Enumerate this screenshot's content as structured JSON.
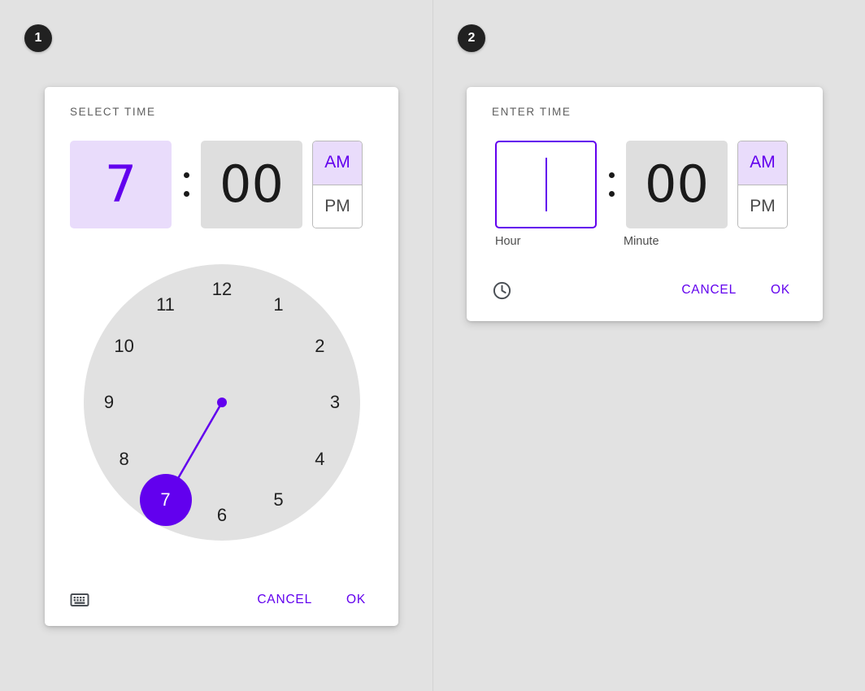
{
  "page": {
    "background_color": "#e2e2e2",
    "accent_color": "#6200ee",
    "accent_soft_color": "#e9dcfb",
    "field_color": "#dedede",
    "clock_face_color": "#e1e1e1"
  },
  "badges": [
    {
      "label": "1"
    },
    {
      "label": "2"
    }
  ],
  "select_time_dialog": {
    "title": "SELECT TIME",
    "hour_value": "7",
    "separator": ":",
    "minute_value": "00",
    "meridiem": {
      "am_label": "AM",
      "pm_label": "PM",
      "selected": "AM"
    },
    "clock": {
      "numbers": [
        "12",
        "1",
        "2",
        "3",
        "4",
        "5",
        "6",
        "7",
        "8",
        "9",
        "10",
        "11"
      ],
      "selected_number": "7"
    },
    "keyboard_icon": "keyboard-icon",
    "cancel_label": "CANCEL",
    "ok_label": "OK"
  },
  "enter_time_dialog": {
    "title": "ENTER TIME",
    "hour_value": "",
    "hour_caption": "Hour",
    "separator": ":",
    "minute_value": "00",
    "minute_caption": "Minute",
    "meridiem": {
      "am_label": "AM",
      "pm_label": "PM",
      "selected": "AM"
    },
    "clock_icon": "clock-icon",
    "cancel_label": "CANCEL",
    "ok_label": "OK"
  }
}
